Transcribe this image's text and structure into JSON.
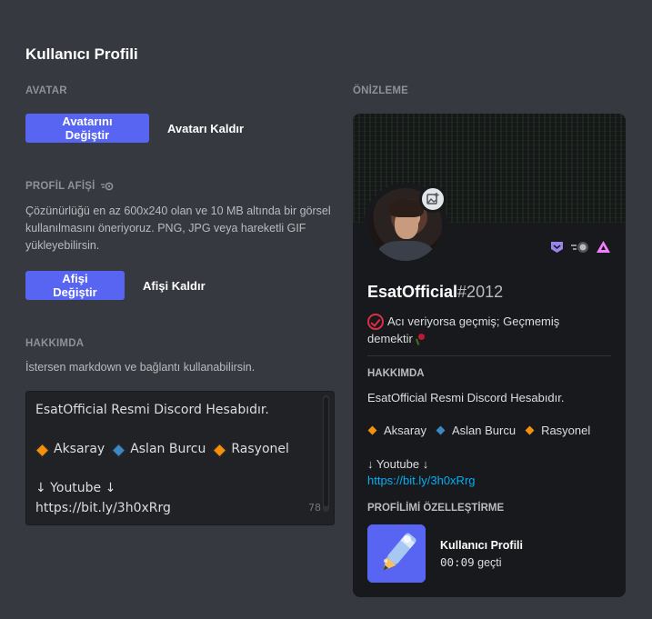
{
  "page": {
    "title": "Kullanıcı Profili"
  },
  "avatar": {
    "label": "AVATAR",
    "change_button": "Avatarını Değiştir",
    "remove_button": "Avatarı Kaldır"
  },
  "banner": {
    "label": "PROFİL AFİŞİ",
    "help": "Çözünürlüğü en az 600x240 olan ve 10 MB altında bir görsel kullanılmasını öneriyoruz. PNG, JPG veya hareketli GIF yükleyebilirsin.",
    "change_button": "Afişi Değiştir",
    "remove_button": "Afişi Kaldır"
  },
  "about": {
    "label": "HAKKIMDA",
    "help": "İstersen markdown ve bağlantı kullanabilirsin.",
    "line1": "EsatOfficial Resmi Discord Hesabıdır.",
    "tags": [
      "Aksaray",
      "Aslan Burcu",
      "Rasyonel"
    ],
    "youtube_label": "↓ Youtube ↓",
    "youtube_url": "https://bit.ly/3h0xRrg",
    "char_count": "78"
  },
  "preview": {
    "label": "ÖNİZLEME",
    "username": "EsatOfficial",
    "discriminator": "#2012",
    "status_line1": "Acı veriyorsa geçmiş; Geçmemiş",
    "status_line2": "demektir",
    "about_heading": "HAKKIMDA",
    "about_line1": "EsatOfficial Resmi Discord Hesabıdır.",
    "tags": [
      "Aksaray",
      "Aslan Burcu",
      "Rasyonel"
    ],
    "youtube_label": "↓ Youtube ↓",
    "youtube_url": "https://bit.ly/3h0xRrg",
    "activity_heading": "PROFİLİMİ ÖZELLEŞTİRME",
    "activity_title": "Kullanıcı Profili",
    "activity_elapsed": "00:09",
    "activity_suffix": "geçti"
  },
  "colors": {
    "background": "#36393f",
    "accent": "#5865f2",
    "card": "#18191c",
    "link": "#00aff4"
  },
  "icons": [
    "nitro-icon",
    "add-image-icon",
    "hypesquad-icon",
    "nitro-boost-icon",
    "early-supporter-icon",
    "status-check-icon",
    "rose-emoji",
    "pencil-icon"
  ]
}
